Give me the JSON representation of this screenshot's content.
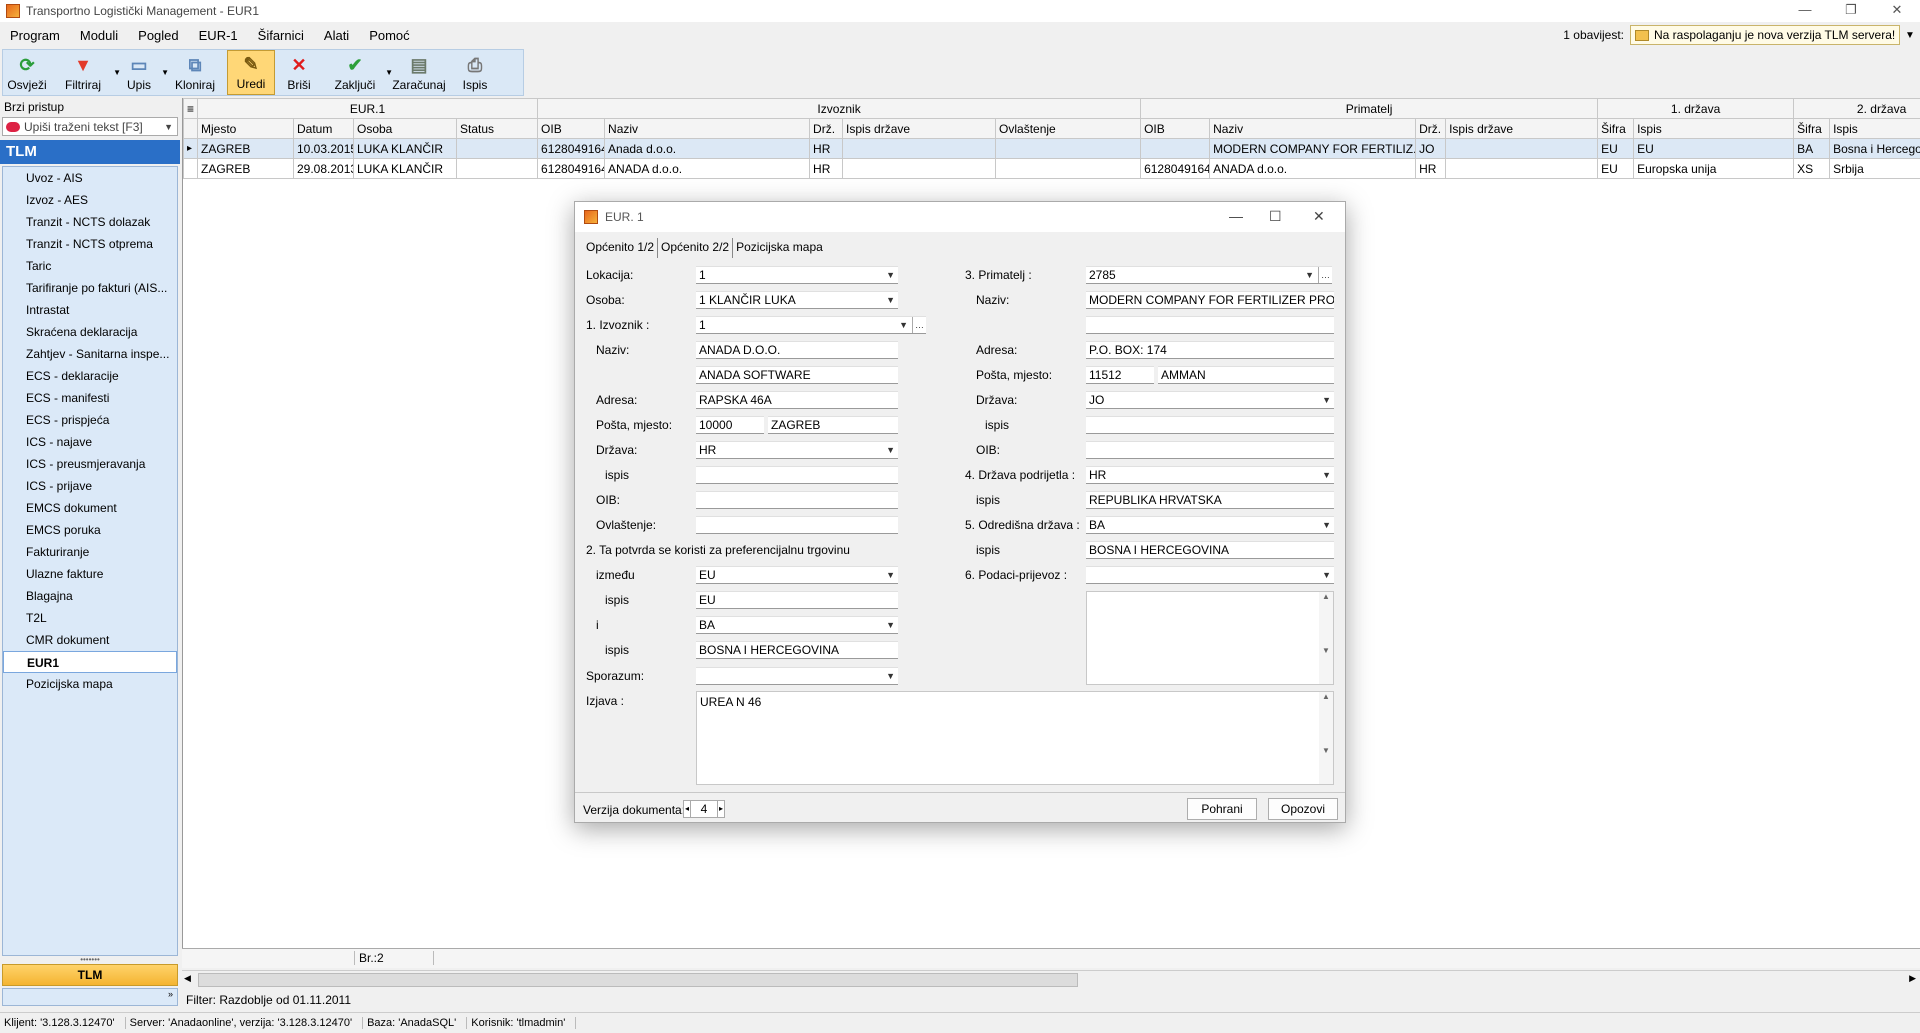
{
  "window": {
    "title": "Transportno Logistički Management - EUR1",
    "min": "—",
    "max": "❐",
    "close": "✕"
  },
  "menu": [
    "Program",
    "Moduli",
    "Pogled",
    "EUR-1",
    "Šifarnici",
    "Alati",
    "Pomoć"
  ],
  "notify": {
    "label": "1 obavijest:",
    "text": "Na raspolaganju je nova verzija TLM servera!"
  },
  "toolbar": [
    {
      "label": "Osvježi",
      "icon": "refresh-icon",
      "glyph": "⟳",
      "color": "#2a9d3a"
    },
    {
      "label": "Filtriraj",
      "icon": "filter-icon",
      "glyph": "▼",
      "color": "#e23a2a"
    },
    {
      "label": "Upis",
      "icon": "new-document-icon",
      "glyph": "▭",
      "color": "#5d86b8"
    },
    {
      "label": "Kloniraj",
      "icon": "clone-icon",
      "glyph": "⧉",
      "color": "#5d86b8"
    },
    {
      "label": "Uredi",
      "icon": "edit-icon",
      "glyph": "✎",
      "color": "#7a5a10"
    },
    {
      "label": "Briši",
      "icon": "delete-icon",
      "glyph": "✕",
      "color": "#e01b1b"
    },
    {
      "label": "Zaključi",
      "icon": "checkmark-icon",
      "glyph": "✔",
      "color": "#2ca03a"
    },
    {
      "label": "Zaračunaj",
      "icon": "money-icon",
      "glyph": "▤",
      "color": "#6b7a6b"
    },
    {
      "label": "Ispis",
      "icon": "printer-icon",
      "glyph": "⎙",
      "color": "#777"
    }
  ],
  "sidebar": {
    "quick_label": "Brzi pristup",
    "quick_placeholder": "Upiši traženi tekst [F3]",
    "header": "TLM",
    "items": [
      "Uvoz - AIS",
      "Izvoz - AES",
      "Tranzit - NCTS dolazak",
      "Tranzit - NCTS otprema",
      "Taric",
      "Tarifiranje po fakturi (AIS...",
      "Intrastat",
      "Skraćena deklaracija",
      "Zahtjev - Sanitarna inspe...",
      "ECS - deklaracije",
      "ECS - manifesti",
      "ECS - prispjeća",
      "ICS - najave",
      "ICS - preusmjeravanja",
      "ICS - prijave",
      "EMCS dokument",
      "EMCS poruka",
      "Fakturiranje",
      "Ulazne fakture",
      "Blagajna",
      "T2L",
      "CMR dokument",
      "EUR1",
      "Pozicijska mapa"
    ],
    "selected": "EUR1",
    "bottom": "TLM"
  },
  "grid": {
    "groups": [
      "EUR.1",
      "Izvoznik",
      "Primatelj",
      "1. država",
      "2. država"
    ],
    "columns": [
      "Mjesto",
      "Datum",
      "Osoba",
      "Status",
      "OIB",
      "Naziv",
      "Drž.",
      "Ispis države",
      "Ovlaštenje",
      "OIB",
      "Naziv",
      "Drž.",
      "Ispis države",
      "Šifra",
      "Ispis",
      "Šifra",
      "Ispis"
    ],
    "rows": [
      [
        "ZAGREB",
        "10.03.2015",
        "LUKA KLANČIR",
        "",
        "6128049164",
        "Anada d.o.o.",
        "HR",
        "",
        "",
        "",
        "MODERN COMPANY FOR FERTILIZ...",
        "JO",
        "",
        "EU",
        "EU",
        "BA",
        "Bosna i Hercegovina"
      ],
      [
        "ZAGREB",
        "29.08.2013",
        "LUKA KLANČIR",
        "",
        "6128049164",
        "ANADA d.o.o.",
        "HR",
        "",
        "",
        "6128049164",
        "ANADA d.o.o.",
        "HR",
        "",
        "EU",
        "Europska unija",
        "XS",
        "Srbija"
      ]
    ],
    "count": "Br.:2",
    "filter": "Filter: Razdoblje od 01.11.2011"
  },
  "status": [
    "Klijent: '3.128.3.12470'",
    "Server: 'Anadaonline', verzija: '3.128.3.12470'",
    "Baza: 'AnadaSQL'",
    "Korisnik: 'tlmadmin'"
  ],
  "dialog": {
    "title": "EUR. 1",
    "tabs": [
      "Općenito 1/2",
      "Općenito 2/2",
      "Pozicijska mapa"
    ],
    "lokacija_l": "Lokacija:",
    "lokacija": "1",
    "osoba_l": "Osoba:",
    "osoba": "1 KLANČIR LUKA",
    "izvoznik_l": "1. Izvoznik :",
    "izvoznik": "1",
    "naziv_l": "Naziv:",
    "naziv1": "ANADA D.O.O.",
    "naziv2": "ANADA SOFTWARE",
    "adresa_l": "Adresa:",
    "adresa": "RAPSKA 46A",
    "posta_l": "Pošta, mjesto:",
    "posta": "10000",
    "mjesto": "ZAGREB",
    "drzava_l": "Država:",
    "drzava": "HR",
    "ispis_l": "ispis",
    "drzava_ispis": "",
    "oib_l": "OIB:",
    "oib": "",
    "ovl_l": "Ovlaštenje:",
    "ovl": "",
    "pref_l": "2. Ta potvrda se koristi za preferencijalnu trgovinu",
    "izmedju_l": "između",
    "izmedju": "EU",
    "izmedju_ispis": "EU",
    "i_l": "i",
    "i": "BA",
    "i_ispis": "BOSNA I HERCEGOVINA",
    "sporazum_l": "Sporazum:",
    "sporazum": "",
    "prim_l": "3. Primatelj :",
    "prim": "2785",
    "p_naziv_l": "Naziv:",
    "p_naziv1": "MODERN COMPANY FOR FERTILIZER PRODUC",
    "p_naziv2": "",
    "p_adresa_l": "Adresa:",
    "p_adresa": "P.O. BOX: 174",
    "p_posta_l": "Pošta, mjesto:",
    "p_posta": "11512",
    "p_mjesto": "AMMAN",
    "p_drzava_l": "Država:",
    "p_drzava": "JO",
    "p_ispis_l": "ispis",
    "p_ispis": "",
    "p_oib_l": "OIB:",
    "p_oib": "",
    "podr_l": "4. Država podrijetla :",
    "podr": "HR",
    "podr_ispis_l": "ispis",
    "podr_ispis": "REPUBLIKA HRVATSKA",
    "odr_l": "5. Odredišna država :",
    "odr": "BA",
    "odr_ispis_l": "ispis",
    "odr_ispis": "BOSNA I HERCEGOVINA",
    "prijevoz_l": "6. Podaci-prijevoz :",
    "prijevoz": "",
    "izjava_l": "Izjava :",
    "izjava": "UREA N 46",
    "verzija_l": "Verzija dokumenta:",
    "verzija": "4",
    "save": "Pohrani",
    "cancel": "Opozovi"
  }
}
